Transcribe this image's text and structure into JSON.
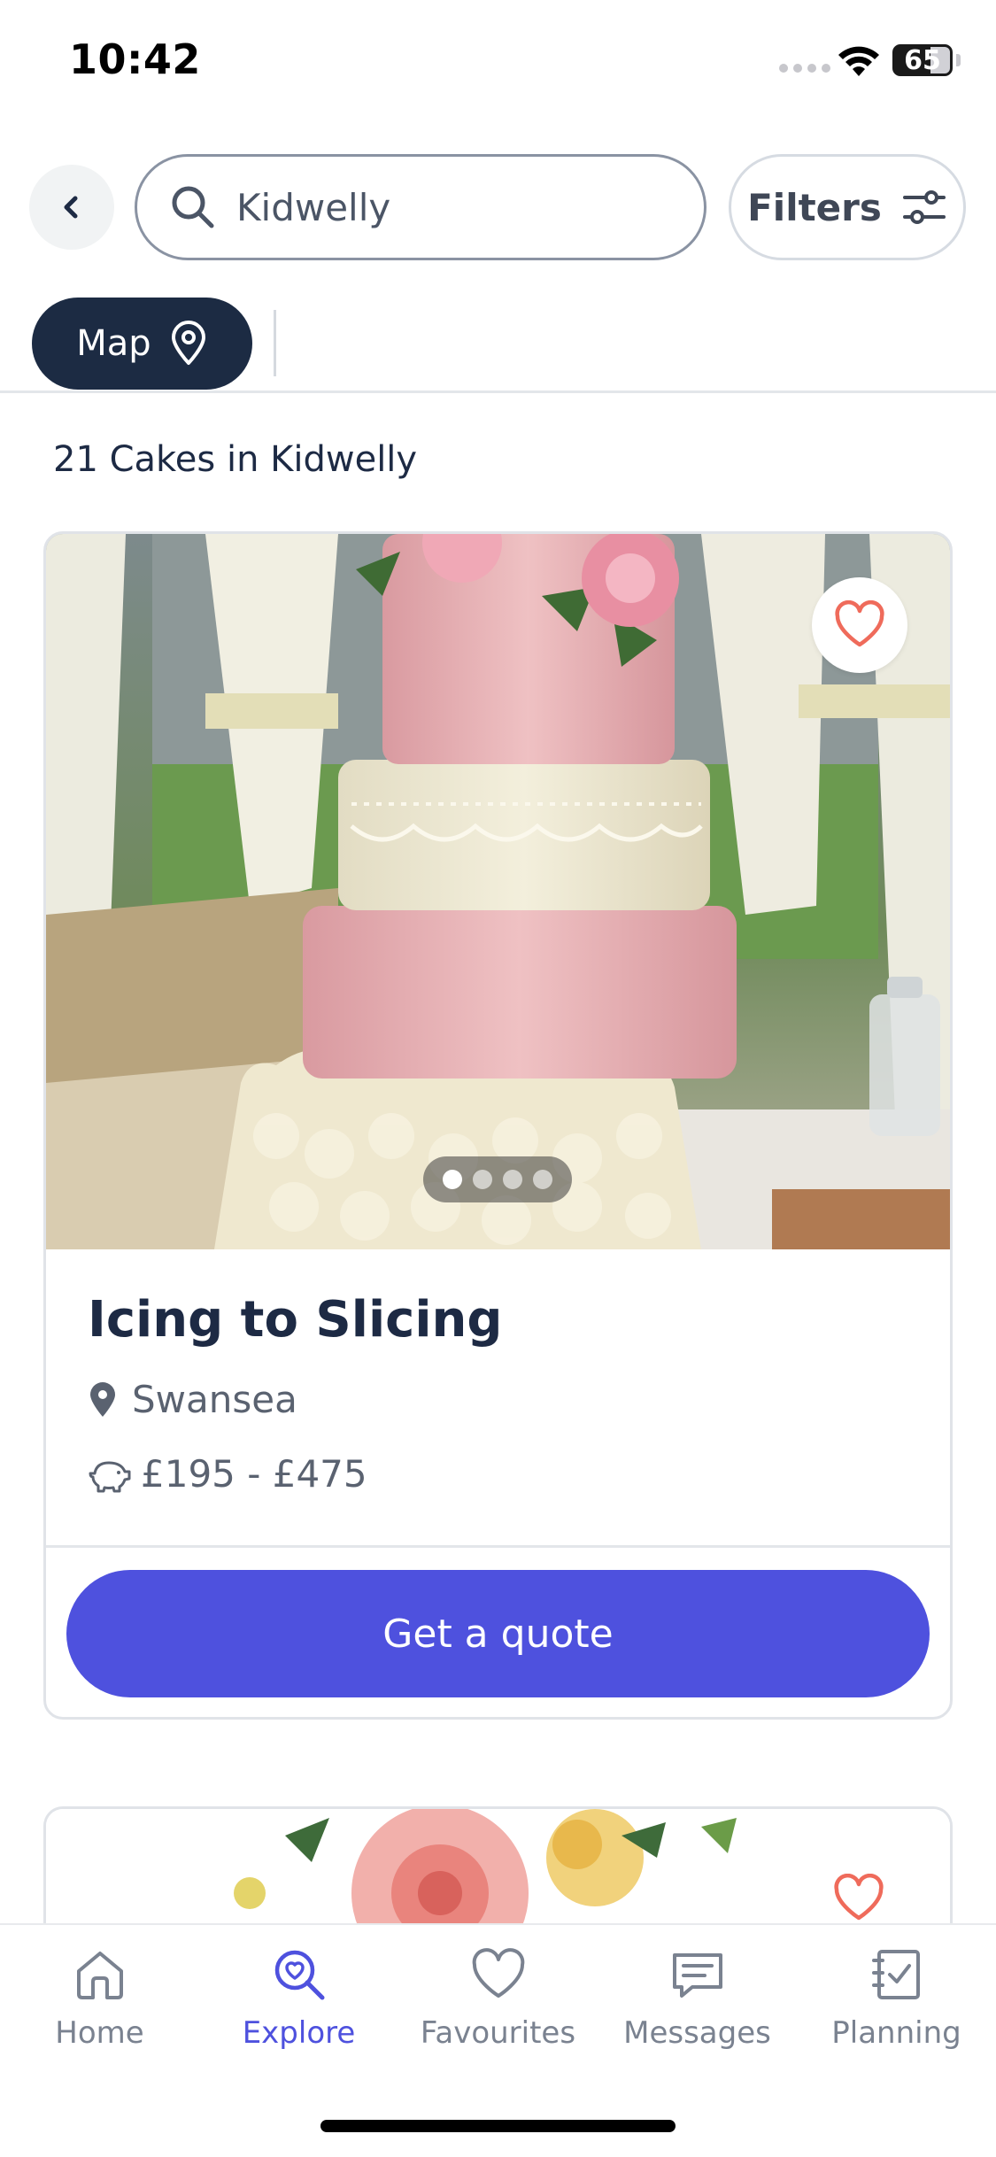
{
  "status_bar": {
    "time": "10:42",
    "battery": "65",
    "battery_level": 0.65
  },
  "search": {
    "value": "Kidwelly",
    "placeholder": "Search"
  },
  "filters": {
    "label": "Filters"
  },
  "map_chip": {
    "label": "Map"
  },
  "results": {
    "count_text": "21 Cakes in Kidwelly"
  },
  "listing": {
    "title": "Icing to Slicing",
    "location": "Swansea",
    "price": "£195 - £475",
    "image_count": 4,
    "active_image": 1,
    "cta_label": "Get a quote"
  },
  "tabs": [
    {
      "label": "Home",
      "icon": "home-icon",
      "active": false
    },
    {
      "label": "Explore",
      "icon": "explore-icon",
      "active": true
    },
    {
      "label": "Favourites",
      "icon": "heart-icon",
      "active": false
    },
    {
      "label": "Messages",
      "icon": "message-icon",
      "active": false
    },
    {
      "label": "Planning",
      "icon": "checklist-icon",
      "active": false
    }
  ],
  "colors": {
    "primary": "#4e51de",
    "navy": "#1c2b43",
    "favourite": "#ef6b5b",
    "text_muted": "#5a6270"
  }
}
